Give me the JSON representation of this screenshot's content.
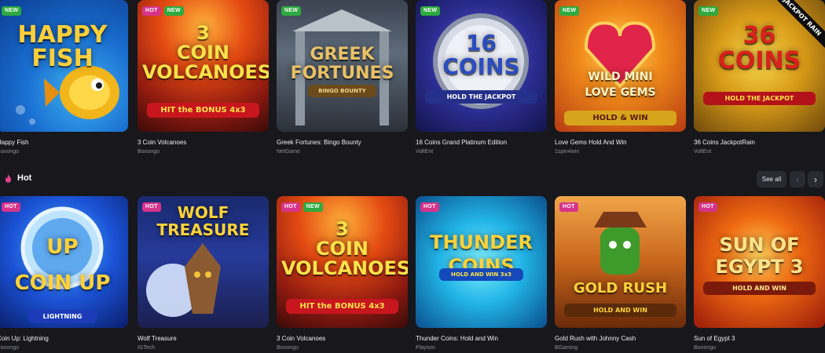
{
  "row1": {
    "games": [
      {
        "title": "Happy Fish",
        "provider": "Booongo",
        "badges": [
          "NEW"
        ],
        "art_title": "HAPPY\nFISH",
        "art_sub": ""
      },
      {
        "title": "3 Coin Volcanoes",
        "provider": "Booongo",
        "badges": [
          "HOT",
          "NEW"
        ],
        "art_title": "3\nCOIN\nVOLCANOES",
        "art_sub": "HIT the BONUS 4x3"
      },
      {
        "title": "Greek Fortunes: Bingo Bounty",
        "provider": "NetGame",
        "badges": [
          "NEW"
        ],
        "art_title": "GREEK\nFORTUNES",
        "art_sub": "BINGO BOUNTY"
      },
      {
        "title": "16 Coins Grand Platinum Edition",
        "provider": "VoltEnt",
        "badges": [
          "NEW"
        ],
        "art_title": "16\nCOINS",
        "art_sub": "HOLD THE JACKPOT"
      },
      {
        "title": "Love Gems Hold And Win",
        "provider": "1spin4win",
        "badges": [
          "NEW"
        ],
        "art_title": "WILD  MINI\nLOVE GEMS",
        "art_sub": "HOLD & WIN"
      },
      {
        "title": "36 Coins JackpotRain",
        "provider": "VoltEnt",
        "badges": [
          "NEW"
        ],
        "art_title": "36\nCOINS",
        "art_sub": "HOLD THE JACKPOT",
        "ribbon": "JACKPOT RAIN"
      }
    ]
  },
  "hot_section": {
    "title": "Hot",
    "see_all_label": "See all",
    "prev_icon": "‹",
    "next_icon": "›"
  },
  "row2": {
    "games": [
      {
        "title": "Coin Up: Lightning",
        "provider": "Booongo",
        "badges": [
          "HOT"
        ],
        "art_title": "UP\nCOIN UP",
        "art_sub": "LIGHTNING"
      },
      {
        "title": "Wolf Treasure",
        "provider": "IGTech",
        "badges": [
          "HOT"
        ],
        "art_title": "WOLF\nTREASURE",
        "art_sub": ""
      },
      {
        "title": "3 Coin Volcanoes",
        "provider": "Booongo",
        "badges": [
          "HOT",
          "NEW"
        ],
        "art_title": "3\nCOIN\nVOLCANOES",
        "art_sub": "HIT the BONUS 4x3"
      },
      {
        "title": "Thunder Coins: Hold and Win",
        "provider": "Playson",
        "badges": [
          "HOT"
        ],
        "art_title": "THUNDER\nCOINS",
        "art_sub": "HOLD AND WIN 3x3"
      },
      {
        "title": "Gold Rush with Johnny Cash",
        "provider": "BGaming",
        "badges": [
          "HOT"
        ],
        "art_title": "GOLD RUSH",
        "art_sub": "HOLD AND WIN"
      },
      {
        "title": "Sun of Egypt 3",
        "provider": "Booongo",
        "badges": [
          "HOT"
        ],
        "art_title": "SUN OF\nEGYPT 3",
        "art_sub": "HOLD AND WIN"
      }
    ]
  },
  "colors": {
    "background": "#17171c",
    "badge_new": "#2eaa3f",
    "badge_hot": "#d6338a",
    "accent_flame": "#e0408f"
  },
  "icons": {
    "section_icon": "flame-icon",
    "prev": "chevron-left-icon",
    "next": "chevron-right-icon"
  }
}
